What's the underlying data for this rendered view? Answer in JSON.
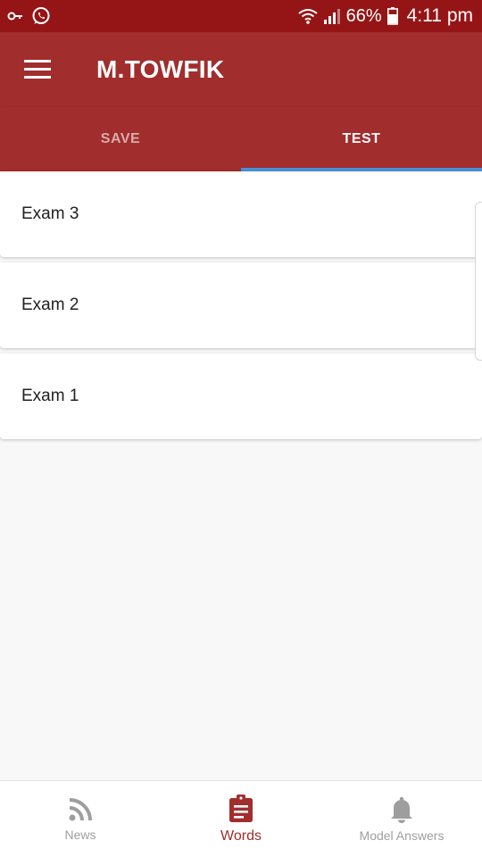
{
  "status_bar": {
    "battery": "66%",
    "time": "4:11 pm",
    "icons": [
      "key-icon",
      "whatsapp-icon",
      "wifi-icon",
      "signal-icon",
      "battery-icon"
    ]
  },
  "app_bar": {
    "title": "M.TOWFIK",
    "menu_icon": "hamburger-menu-icon"
  },
  "tabs": [
    {
      "label": "SAVE",
      "active": false
    },
    {
      "label": "TEST",
      "active": true
    }
  ],
  "exams": [
    {
      "label": "Exam 3"
    },
    {
      "label": "Exam 2"
    },
    {
      "label": "Exam 1"
    }
  ],
  "bottom_nav": [
    {
      "label": "News",
      "icon": "rss-feed-icon",
      "active": false
    },
    {
      "label": "Words",
      "icon": "clipboard-icon",
      "active": true
    },
    {
      "label": "Model Answers",
      "icon": "bell-icon",
      "active": false
    }
  ],
  "colors": {
    "status_bar": "#951516",
    "primary": "#a12d2d",
    "tab_indicator": "#4a90d9",
    "inactive": "#9e9e9e"
  }
}
